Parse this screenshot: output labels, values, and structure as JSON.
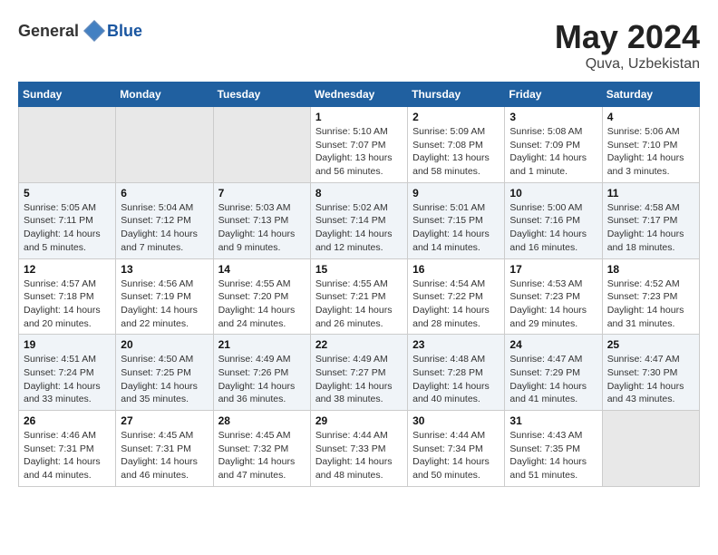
{
  "logo": {
    "general": "General",
    "blue": "Blue"
  },
  "title": {
    "month": "May 2024",
    "location": "Quva, Uzbekistan"
  },
  "headers": [
    "Sunday",
    "Monday",
    "Tuesday",
    "Wednesday",
    "Thursday",
    "Friday",
    "Saturday"
  ],
  "weeks": [
    [
      {
        "day": "",
        "sunrise": "",
        "sunset": "",
        "daylight": "",
        "empty": true
      },
      {
        "day": "",
        "sunrise": "",
        "sunset": "",
        "daylight": "",
        "empty": true
      },
      {
        "day": "",
        "sunrise": "",
        "sunset": "",
        "daylight": "",
        "empty": true
      },
      {
        "day": "1",
        "sunrise": "Sunrise: 5:10 AM",
        "sunset": "Sunset: 7:07 PM",
        "daylight": "Daylight: 13 hours and 56 minutes."
      },
      {
        "day": "2",
        "sunrise": "Sunrise: 5:09 AM",
        "sunset": "Sunset: 7:08 PM",
        "daylight": "Daylight: 13 hours and 58 minutes."
      },
      {
        "day": "3",
        "sunrise": "Sunrise: 5:08 AM",
        "sunset": "Sunset: 7:09 PM",
        "daylight": "Daylight: 14 hours and 1 minute."
      },
      {
        "day": "4",
        "sunrise": "Sunrise: 5:06 AM",
        "sunset": "Sunset: 7:10 PM",
        "daylight": "Daylight: 14 hours and 3 minutes."
      }
    ],
    [
      {
        "day": "5",
        "sunrise": "Sunrise: 5:05 AM",
        "sunset": "Sunset: 7:11 PM",
        "daylight": "Daylight: 14 hours and 5 minutes."
      },
      {
        "day": "6",
        "sunrise": "Sunrise: 5:04 AM",
        "sunset": "Sunset: 7:12 PM",
        "daylight": "Daylight: 14 hours and 7 minutes."
      },
      {
        "day": "7",
        "sunrise": "Sunrise: 5:03 AM",
        "sunset": "Sunset: 7:13 PM",
        "daylight": "Daylight: 14 hours and 9 minutes."
      },
      {
        "day": "8",
        "sunrise": "Sunrise: 5:02 AM",
        "sunset": "Sunset: 7:14 PM",
        "daylight": "Daylight: 14 hours and 12 minutes."
      },
      {
        "day": "9",
        "sunrise": "Sunrise: 5:01 AM",
        "sunset": "Sunset: 7:15 PM",
        "daylight": "Daylight: 14 hours and 14 minutes."
      },
      {
        "day": "10",
        "sunrise": "Sunrise: 5:00 AM",
        "sunset": "Sunset: 7:16 PM",
        "daylight": "Daylight: 14 hours and 16 minutes."
      },
      {
        "day": "11",
        "sunrise": "Sunrise: 4:58 AM",
        "sunset": "Sunset: 7:17 PM",
        "daylight": "Daylight: 14 hours and 18 minutes."
      }
    ],
    [
      {
        "day": "12",
        "sunrise": "Sunrise: 4:57 AM",
        "sunset": "Sunset: 7:18 PM",
        "daylight": "Daylight: 14 hours and 20 minutes."
      },
      {
        "day": "13",
        "sunrise": "Sunrise: 4:56 AM",
        "sunset": "Sunset: 7:19 PM",
        "daylight": "Daylight: 14 hours and 22 minutes."
      },
      {
        "day": "14",
        "sunrise": "Sunrise: 4:55 AM",
        "sunset": "Sunset: 7:20 PM",
        "daylight": "Daylight: 14 hours and 24 minutes."
      },
      {
        "day": "15",
        "sunrise": "Sunrise: 4:55 AM",
        "sunset": "Sunset: 7:21 PM",
        "daylight": "Daylight: 14 hours and 26 minutes."
      },
      {
        "day": "16",
        "sunrise": "Sunrise: 4:54 AM",
        "sunset": "Sunset: 7:22 PM",
        "daylight": "Daylight: 14 hours and 28 minutes."
      },
      {
        "day": "17",
        "sunrise": "Sunrise: 4:53 AM",
        "sunset": "Sunset: 7:23 PM",
        "daylight": "Daylight: 14 hours and 29 minutes."
      },
      {
        "day": "18",
        "sunrise": "Sunrise: 4:52 AM",
        "sunset": "Sunset: 7:23 PM",
        "daylight": "Daylight: 14 hours and 31 minutes."
      }
    ],
    [
      {
        "day": "19",
        "sunrise": "Sunrise: 4:51 AM",
        "sunset": "Sunset: 7:24 PM",
        "daylight": "Daylight: 14 hours and 33 minutes."
      },
      {
        "day": "20",
        "sunrise": "Sunrise: 4:50 AM",
        "sunset": "Sunset: 7:25 PM",
        "daylight": "Daylight: 14 hours and 35 minutes."
      },
      {
        "day": "21",
        "sunrise": "Sunrise: 4:49 AM",
        "sunset": "Sunset: 7:26 PM",
        "daylight": "Daylight: 14 hours and 36 minutes."
      },
      {
        "day": "22",
        "sunrise": "Sunrise: 4:49 AM",
        "sunset": "Sunset: 7:27 PM",
        "daylight": "Daylight: 14 hours and 38 minutes."
      },
      {
        "day": "23",
        "sunrise": "Sunrise: 4:48 AM",
        "sunset": "Sunset: 7:28 PM",
        "daylight": "Daylight: 14 hours and 40 minutes."
      },
      {
        "day": "24",
        "sunrise": "Sunrise: 4:47 AM",
        "sunset": "Sunset: 7:29 PM",
        "daylight": "Daylight: 14 hours and 41 minutes."
      },
      {
        "day": "25",
        "sunrise": "Sunrise: 4:47 AM",
        "sunset": "Sunset: 7:30 PM",
        "daylight": "Daylight: 14 hours and 43 minutes."
      }
    ],
    [
      {
        "day": "26",
        "sunrise": "Sunrise: 4:46 AM",
        "sunset": "Sunset: 7:31 PM",
        "daylight": "Daylight: 14 hours and 44 minutes."
      },
      {
        "day": "27",
        "sunrise": "Sunrise: 4:45 AM",
        "sunset": "Sunset: 7:31 PM",
        "daylight": "Daylight: 14 hours and 46 minutes."
      },
      {
        "day": "28",
        "sunrise": "Sunrise: 4:45 AM",
        "sunset": "Sunset: 7:32 PM",
        "daylight": "Daylight: 14 hours and 47 minutes."
      },
      {
        "day": "29",
        "sunrise": "Sunrise: 4:44 AM",
        "sunset": "Sunset: 7:33 PM",
        "daylight": "Daylight: 14 hours and 48 minutes."
      },
      {
        "day": "30",
        "sunrise": "Sunrise: 4:44 AM",
        "sunset": "Sunset: 7:34 PM",
        "daylight": "Daylight: 14 hours and 50 minutes."
      },
      {
        "day": "31",
        "sunrise": "Sunrise: 4:43 AM",
        "sunset": "Sunset: 7:35 PM",
        "daylight": "Daylight: 14 hours and 51 minutes."
      },
      {
        "day": "",
        "sunrise": "",
        "sunset": "",
        "daylight": "",
        "empty": true
      }
    ]
  ]
}
